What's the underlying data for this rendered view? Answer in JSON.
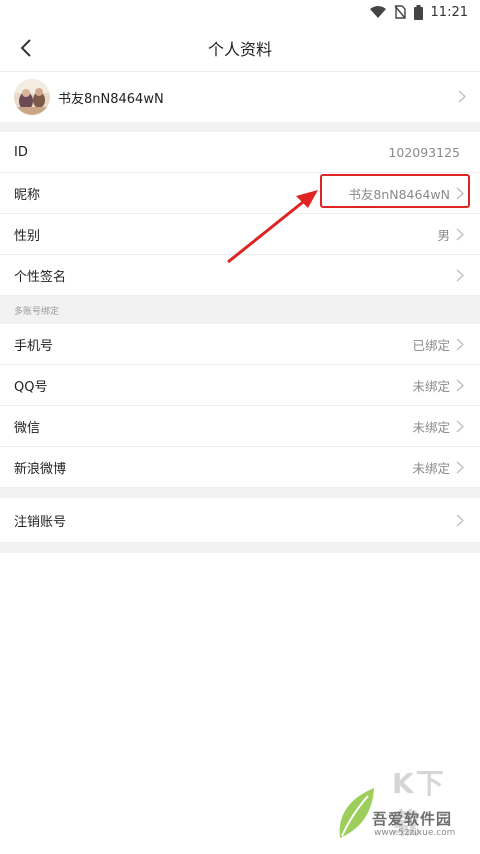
{
  "status_bar": {
    "time": "11:21"
  },
  "header": {
    "title": "个人资料"
  },
  "profile": {
    "name": "书友8nN8464wN"
  },
  "info_rows": [
    {
      "label": "ID",
      "value": "102093125"
    },
    {
      "label": "昵称",
      "value": "书友8nN8464wN"
    },
    {
      "label": "性别",
      "value": "男"
    },
    {
      "label": "个性签名",
      "value": ""
    }
  ],
  "bind_section": {
    "title": "多账号绑定"
  },
  "bind_rows": [
    {
      "label": "手机号",
      "value": "已绑定"
    },
    {
      "label": "QQ号",
      "value": "未绑定"
    },
    {
      "label": "微信",
      "value": "未绑定"
    },
    {
      "label": "新浪微博",
      "value": "未绑定"
    }
  ],
  "cancel_row": {
    "label": "注销账号"
  },
  "watermark": {
    "big": "K下载",
    "name": "吾爱软件园",
    "url": "www.52zixue.com"
  },
  "colors": {
    "highlight": "#e02424",
    "divider": "#efefef",
    "section_bg": "#f2f2f2"
  }
}
